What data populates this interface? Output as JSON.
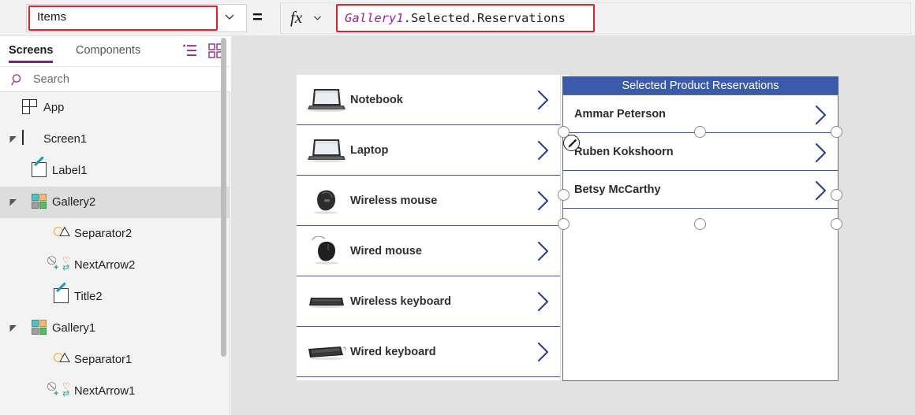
{
  "formula_bar": {
    "property_value": "Items",
    "property_chevron_icon": "chevron-down-icon",
    "equals": "=",
    "fx_label": "fx",
    "fx_chevron_icon": "chevron-down-icon",
    "formula_identifier": "Gallery1",
    "formula_rest": ".Selected.Reservations",
    "highlight_color": "#ee1c25"
  },
  "sidebar": {
    "tabs": [
      {
        "label": "Screens",
        "active": true
      },
      {
        "label": "Components",
        "active": false
      }
    ],
    "view_buttons": [
      {
        "icon": "tree-view-icon"
      },
      {
        "icon": "thumbnail-view-icon"
      }
    ],
    "search": {
      "placeholder": "Search",
      "icon": "search-icon"
    },
    "tree": [
      {
        "label": "App",
        "icon": "app-icon",
        "indent": 0,
        "caret": "none",
        "selected": false
      },
      {
        "label": "Screen1",
        "icon": "screen-icon",
        "indent": 0,
        "caret": "expanded",
        "selected": false
      },
      {
        "label": "Label1",
        "icon": "label-icon",
        "indent": 1,
        "caret": "none",
        "selected": false
      },
      {
        "label": "Gallery2",
        "icon": "gallery-icon",
        "indent": 1,
        "caret": "expanded",
        "selected": true
      },
      {
        "label": "Separator2",
        "icon": "separator-icon",
        "indent": 2,
        "caret": "none",
        "selected": false
      },
      {
        "label": "NextArrow2",
        "icon": "icon-control-icon",
        "indent": 2,
        "caret": "none",
        "selected": false
      },
      {
        "label": "Title2",
        "icon": "label-icon",
        "indent": 2,
        "caret": "none",
        "selected": false
      },
      {
        "label": "Gallery1",
        "icon": "gallery-icon",
        "indent": 1,
        "caret": "expanded",
        "selected": false
      },
      {
        "label": "Separator1",
        "icon": "separator-icon",
        "indent": 2,
        "caret": "none",
        "selected": false
      },
      {
        "label": "NextArrow1",
        "icon": "icon-control-icon",
        "indent": 2,
        "caret": "none",
        "selected": false
      }
    ]
  },
  "canvas": {
    "background_color": "#e2e2e2",
    "product_gallery": {
      "name": "Gallery1",
      "items": [
        {
          "title": "Notebook",
          "thumb": "notebook-photo"
        },
        {
          "title": "Laptop",
          "thumb": "laptop-photo"
        },
        {
          "title": "Wireless mouse",
          "thumb": "wireless-mouse-photo"
        },
        {
          "title": "Wired mouse",
          "thumb": "wired-mouse-photo"
        },
        {
          "title": "Wireless keyboard",
          "thumb": "wireless-keyboard-photo"
        },
        {
          "title": "Wired keyboard",
          "thumb": "wired-keyboard-photo"
        }
      ],
      "arrow_icon": "chevron-right-icon",
      "arrow_color": "#2b3f8f",
      "separator_color": "#41558f"
    },
    "reservations_gallery": {
      "name": "Gallery2",
      "header_title": "Selected Product Reservations",
      "header_color": "#3a5ba9",
      "selected": true,
      "edit_badge_icon": "pencil-edit-icon",
      "items": [
        {
          "name": "Ammar Peterson"
        },
        {
          "name": "Ruben Kokshoorn"
        },
        {
          "name": "Betsy McCarthy"
        }
      ],
      "arrow_icon": "chevron-right-icon"
    }
  }
}
